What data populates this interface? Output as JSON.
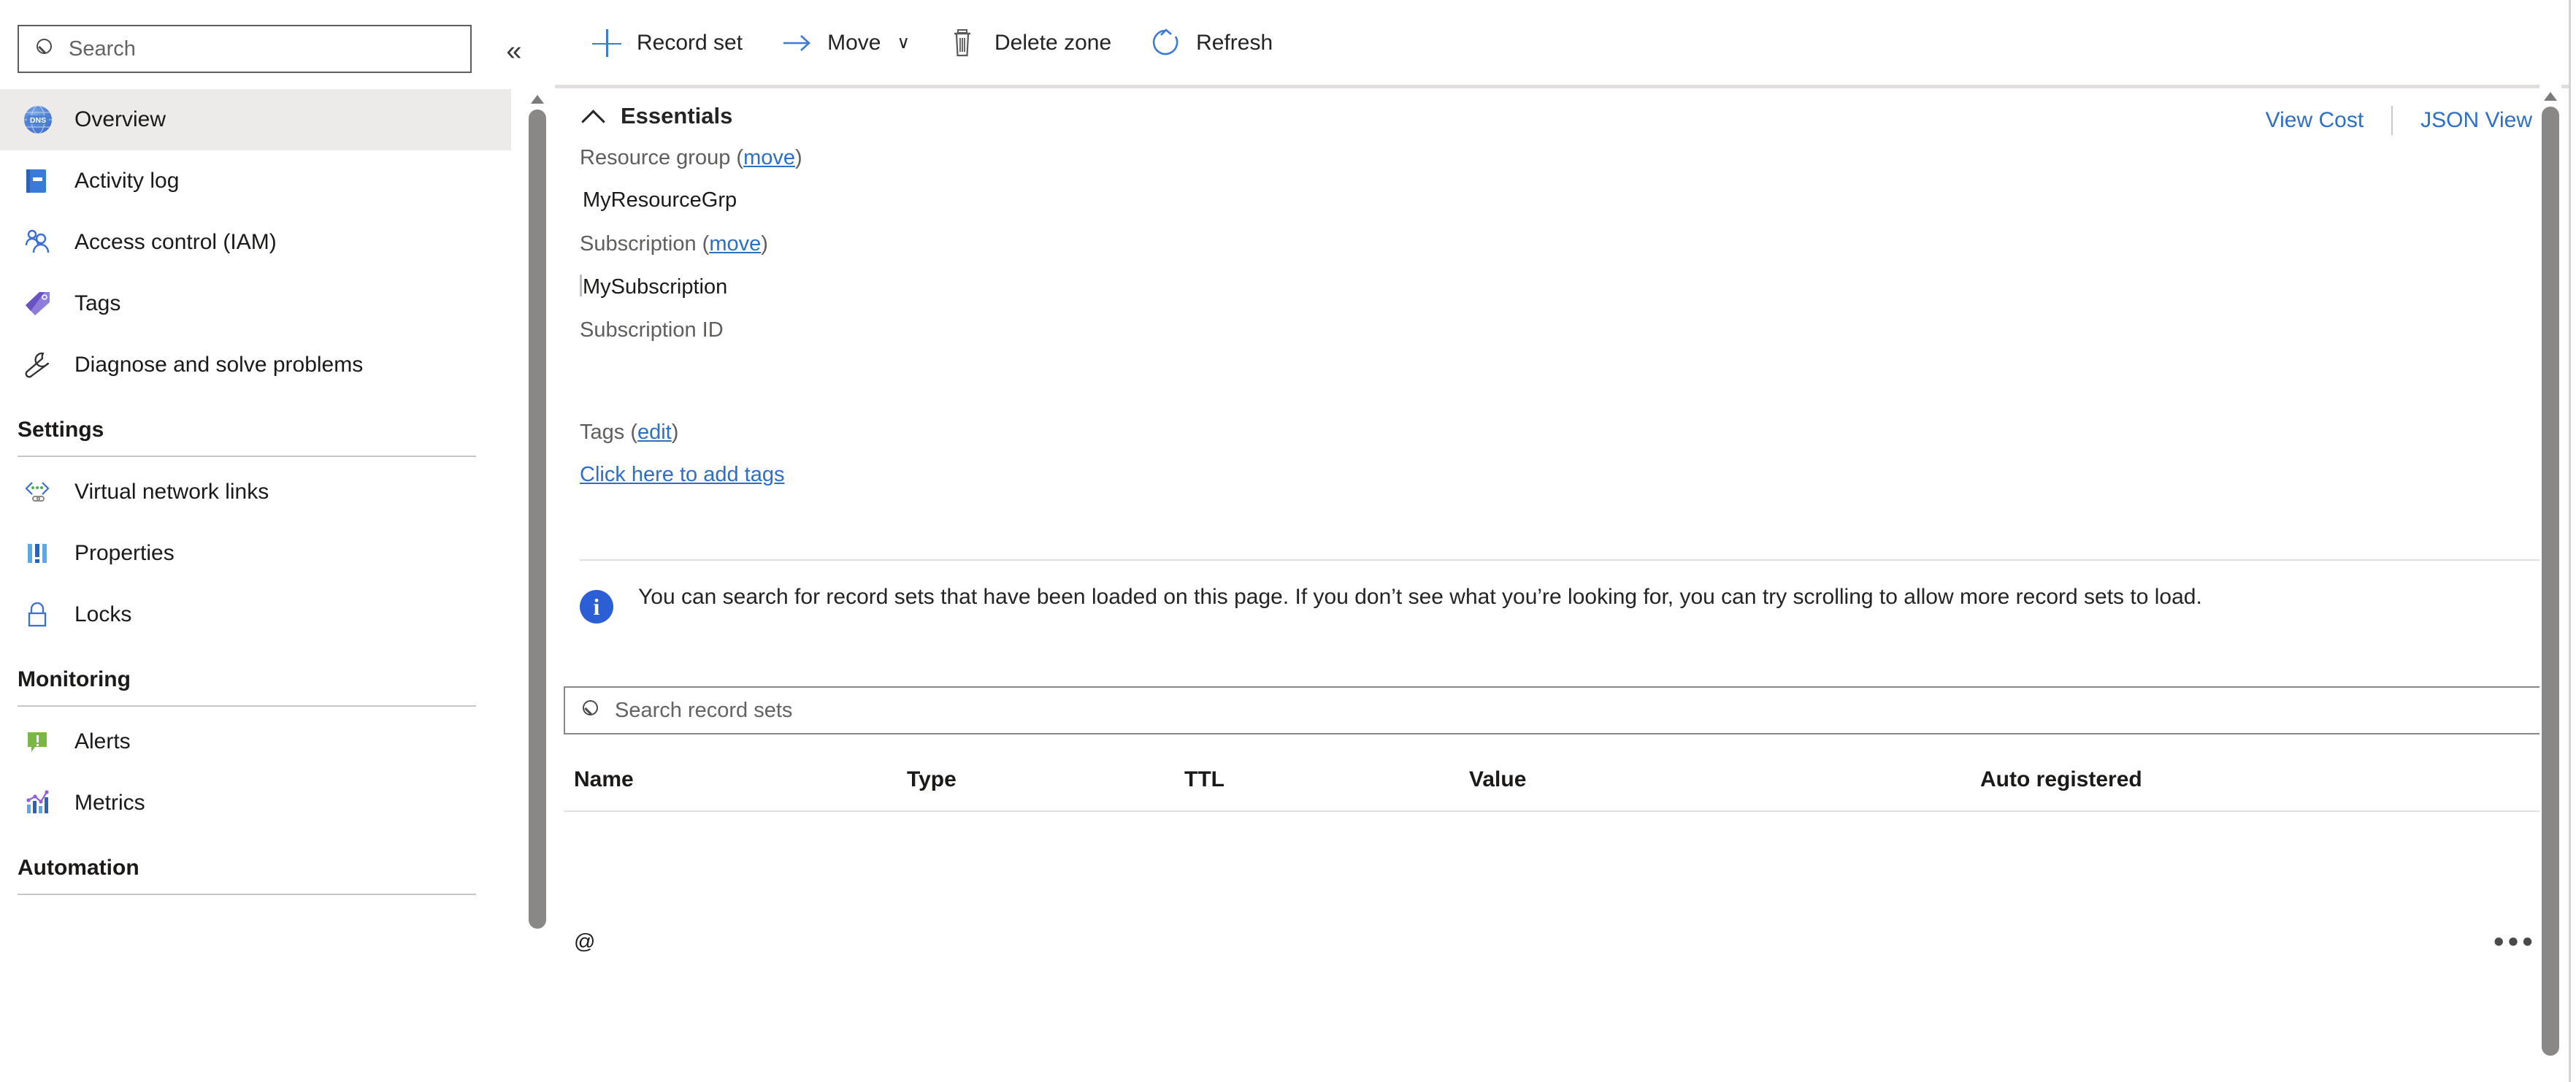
{
  "sidebar": {
    "search": {
      "placeholder": "Search",
      "value": ""
    },
    "collapse_glyph": "«",
    "items": [
      {
        "label": "Overview",
        "icon": "dns-zone-icon",
        "selected": true
      },
      {
        "label": "Activity log",
        "icon": "activity-log-icon",
        "selected": false
      },
      {
        "label": "Access control (IAM)",
        "icon": "access-control-icon",
        "selected": false
      },
      {
        "label": "Tags",
        "icon": "tag-icon",
        "selected": false
      },
      {
        "label": "Diagnose and solve problems",
        "icon": "wrench-icon",
        "selected": false
      }
    ],
    "groups": [
      {
        "title": "Settings",
        "items": [
          {
            "label": "Virtual network links",
            "icon": "virtual-network-link-icon"
          },
          {
            "label": "Properties",
            "icon": "properties-icon"
          },
          {
            "label": "Locks",
            "icon": "lock-icon"
          }
        ]
      },
      {
        "title": "Monitoring",
        "items": [
          {
            "label": "Alerts",
            "icon": "alert-icon"
          },
          {
            "label": "Metrics",
            "icon": "metrics-icon"
          }
        ]
      },
      {
        "title": "Automation",
        "items": []
      }
    ]
  },
  "toolbar": {
    "record_set_label": "Record set",
    "move_label": "Move",
    "move_caret": "∨",
    "delete_zone_label": "Delete zone",
    "refresh_label": "Refresh"
  },
  "essentials": {
    "title": "Essentials",
    "view_cost_label": "View Cost",
    "json_view_label": "JSON View",
    "resource_group_label": "Resource group (",
    "resource_group_move": "move",
    "resource_group_label_close": ")",
    "resource_group_value": "MyResourceGrp",
    "subscription_label": "Subscription (",
    "subscription_move": "move",
    "subscription_label_close": ")",
    "subscription_value": "MySubscription",
    "subscription_id_label": "Subscription ID",
    "subscription_id_value": "",
    "tags_label": "Tags (",
    "tags_edit": "edit",
    "tags_label_close": ")",
    "add_tags_link": "Click here to add tags"
  },
  "info_banner": {
    "text": "You can search for record sets that have been loaded on this page. If you don’t see what you’re looking for, you can try scrolling to allow more record sets to load."
  },
  "record_search": {
    "placeholder": "Search record sets",
    "value": ""
  },
  "table": {
    "columns": [
      "Name",
      "Type",
      "TTL",
      "Value",
      "Auto registered"
    ],
    "rows": [
      {
        "name": "@",
        "type": "",
        "ttl": "",
        "value": "",
        "auto_registered": "",
        "menu": "•••"
      }
    ]
  },
  "colors": {
    "accent_blue": "#2c6fc4",
    "command_blue": "#3b7bd4",
    "selected_bg": "#edebe9",
    "info_blue": "#2c5fd6",
    "divider": "#e1dfdd",
    "scrollbar": "#8a8886"
  }
}
